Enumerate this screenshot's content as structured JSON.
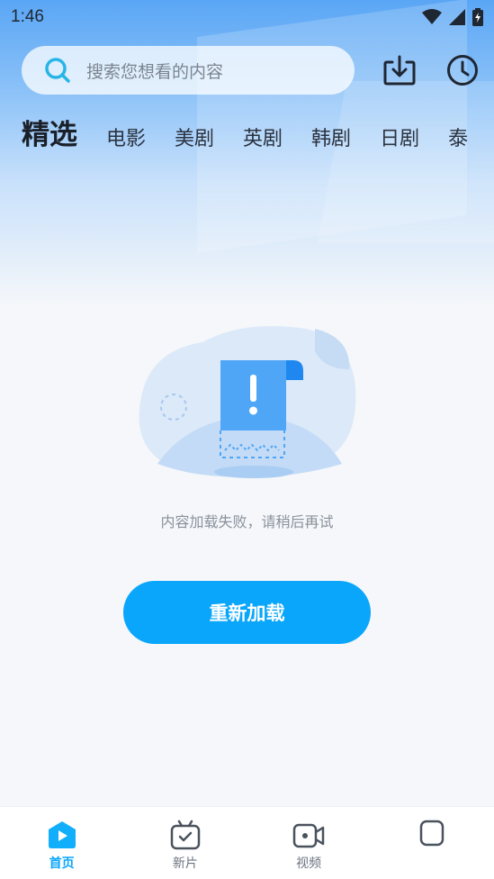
{
  "status_bar": {
    "time": "1:46",
    "icons": [
      "wifi-icon",
      "signal-icon",
      "battery-charging-icon"
    ]
  },
  "search": {
    "placeholder": "搜索您想看的内容",
    "icon": "search-icon"
  },
  "header_actions": [
    {
      "name": "download-icon"
    },
    {
      "name": "history-clock-icon"
    }
  ],
  "tabs": [
    {
      "label": "精选",
      "active": true
    },
    {
      "label": "电影"
    },
    {
      "label": "美剧"
    },
    {
      "label": "英剧"
    },
    {
      "label": "韩剧"
    },
    {
      "label": "日剧"
    },
    {
      "label": "泰"
    }
  ],
  "empty_state": {
    "message": "内容加载失败，请稍后再试",
    "reload_label": "重新加载",
    "illustration": "load-error-flag-icon"
  },
  "bottom_nav": [
    {
      "label": "首页",
      "icon": "home-play-icon",
      "active": true
    },
    {
      "label": "新片",
      "icon": "new-release-tv-icon"
    },
    {
      "label": "视频",
      "icon": "video-camera-icon"
    },
    {
      "label": "",
      "icon": "profile-square-icon"
    }
  ],
  "colors": {
    "accent": "#0aa6fb",
    "text_primary": "#1a2029",
    "text_muted": "#8a929c",
    "background": "#f5f7fa"
  }
}
